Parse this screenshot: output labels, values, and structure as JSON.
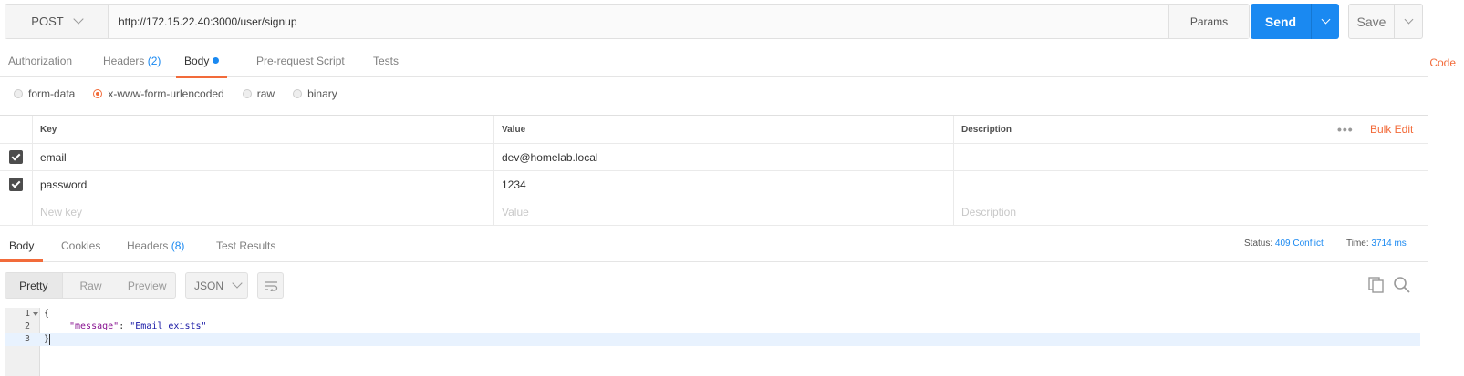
{
  "request": {
    "method": "POST",
    "url": "http://172.15.22.40:3000/user/signup",
    "params_label": "Params",
    "send_label": "Send",
    "save_label": "Save"
  },
  "request_tabs": [
    {
      "label": "Authorization",
      "count": ""
    },
    {
      "label": "Headers",
      "count": "(2)"
    },
    {
      "label": "Body",
      "count": "",
      "active": true,
      "indicator": "blue-dot"
    },
    {
      "label": "Pre-request Script",
      "count": ""
    },
    {
      "label": "Tests",
      "count": ""
    }
  ],
  "code_link": "Code",
  "body_types": [
    {
      "label": "form-data",
      "selected": false
    },
    {
      "label": "x-www-form-urlencoded",
      "selected": true
    },
    {
      "label": "raw",
      "selected": false
    },
    {
      "label": "binary",
      "selected": false
    }
  ],
  "params_table": {
    "headers": {
      "key": "Key",
      "value": "Value",
      "description": "Description"
    },
    "more_label": "•••",
    "bulk_edit_label": "Bulk Edit",
    "rows": [
      {
        "checked": true,
        "key": "email",
        "value": "dev@homelab.local",
        "description": ""
      },
      {
        "checked": true,
        "key": "password",
        "value": "1234",
        "description": ""
      }
    ],
    "placeholders": {
      "key": "New key",
      "value": "Value",
      "description": "Description"
    }
  },
  "response_tabs": [
    {
      "label": "Body",
      "count": "",
      "active": true
    },
    {
      "label": "Cookies",
      "count": ""
    },
    {
      "label": "Headers",
      "count": "(8)"
    },
    {
      "label": "Test Results",
      "count": ""
    }
  ],
  "response_meta": {
    "status_label": "Status:",
    "status_value": "409 Conflict",
    "time_label": "Time:",
    "time_value": "3714 ms"
  },
  "viewer": {
    "modes": [
      "Pretty",
      "Raw",
      "Preview"
    ],
    "active_mode": "Pretty",
    "format": "JSON",
    "icons": [
      "wrap-lines-icon",
      "copy-icon",
      "search-icon"
    ]
  },
  "response_body": {
    "line_numbers": [
      "1",
      "2",
      "3"
    ],
    "open_brace": "{",
    "key": "\"message\"",
    "separator": ": ",
    "value": "\"Email exists\"",
    "close_brace": "}"
  },
  "colors": {
    "accent": "#f26b3a",
    "send_button": "#1a89f1",
    "link_blue": "#1a89f1"
  }
}
